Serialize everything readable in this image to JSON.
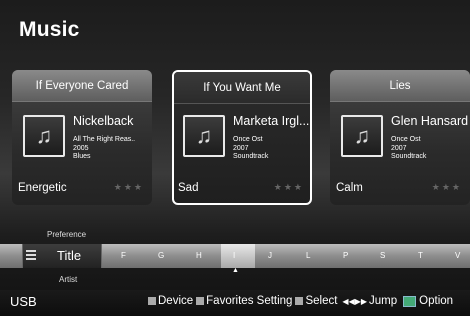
{
  "header": {
    "title": "Music"
  },
  "cards": [
    {
      "song": "If Everyone Cared",
      "artist": "Nickelback",
      "album_lines": [
        "All The Right Reas..",
        "2005",
        "Blues"
      ],
      "mood": "Energetic",
      "stars": "★★★",
      "selected": false
    },
    {
      "song": "If You Want Me",
      "artist": "Marketa Irgl...",
      "album_lines": [
        "Once Ost",
        "2007",
        "Soundtrack"
      ],
      "mood": "Sad",
      "stars": "★★★",
      "selected": true
    },
    {
      "song": "Lies",
      "artist": "Glen Hansard",
      "album_lines": [
        "Once Ost",
        "2007",
        "Soundtrack"
      ],
      "mood": "Calm",
      "stars": "★★★",
      "selected": false
    }
  ],
  "sort": {
    "prev": "Preference",
    "current": "Title",
    "next": "Artist",
    "letters": [
      "F",
      "G",
      "H",
      "I",
      "J",
      "L",
      "P",
      "S",
      "T",
      "V"
    ],
    "active_letter": "I"
  },
  "footer": {
    "device": "USB",
    "hints": [
      {
        "key": "Device",
        "color": "#aaaaaa"
      },
      {
        "key": "Favorites Setting",
        "color": "#aaaaaa"
      },
      {
        "key": "Select",
        "color": "#aaaaaa"
      }
    ],
    "jump": "Jump",
    "option": "Option"
  }
}
